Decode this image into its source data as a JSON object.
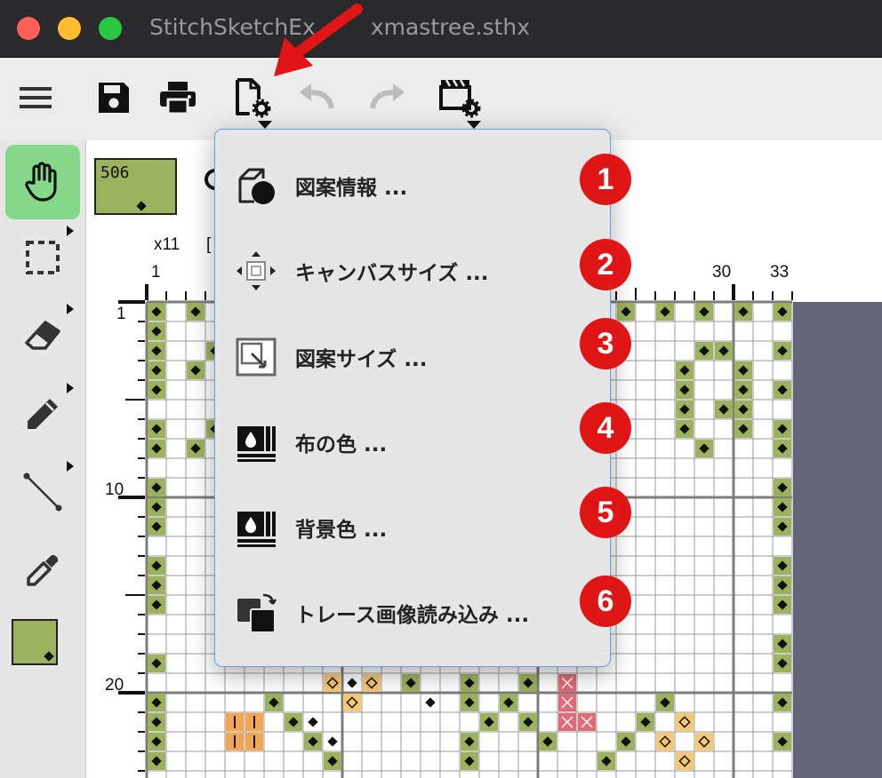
{
  "window": {
    "title": "StitchSketch Ex - xmastree.sthx",
    "title_visible_left": "StitchSketchEx",
    "title_visible_right": "xmastree.sthx",
    "traffic_lights": [
      "#ff5f57",
      "#febc2e",
      "#28c840"
    ]
  },
  "toolbar": {
    "items": [
      "menu-icon",
      "save-icon",
      "print-icon",
      "document-settings-icon",
      "undo-icon",
      "redo-icon",
      "video-settings-icon"
    ]
  },
  "tools": [
    "hand-icon",
    "selection-icon",
    "eraser-icon",
    "pencil-icon",
    "line-icon",
    "eyedropper-icon"
  ],
  "current_color": {
    "number": "506",
    "hex": "#9db25e"
  },
  "canvas": {
    "zoom_label": "x11",
    "zoom_bracket": "[",
    "top_ruler": [
      "1",
      "30",
      "33"
    ],
    "left_ruler": [
      "1",
      "10",
      "20"
    ],
    "colors": {
      "green": "#9db25e",
      "yellow": "#f5c874",
      "orange": "#f3a64f",
      "red": "#e06a76",
      "gray_area": "#65657a"
    }
  },
  "menu": {
    "items": [
      {
        "label": "図案情報 ...",
        "icon": "pattern-info-icon",
        "badge": "1"
      },
      {
        "label": "キャンバスサイズ ...",
        "icon": "canvas-size-icon",
        "badge": "2"
      },
      {
        "label": "図案サイズ ...",
        "icon": "pattern-size-icon",
        "badge": "3"
      },
      {
        "label": "布の色 ...",
        "icon": "fabric-color-icon",
        "badge": "4"
      },
      {
        "label": "背景色 ...",
        "icon": "background-color-icon",
        "badge": "5"
      },
      {
        "label": "トレース画像読み込み ...",
        "icon": "trace-image-icon",
        "badge": "6"
      }
    ]
  }
}
